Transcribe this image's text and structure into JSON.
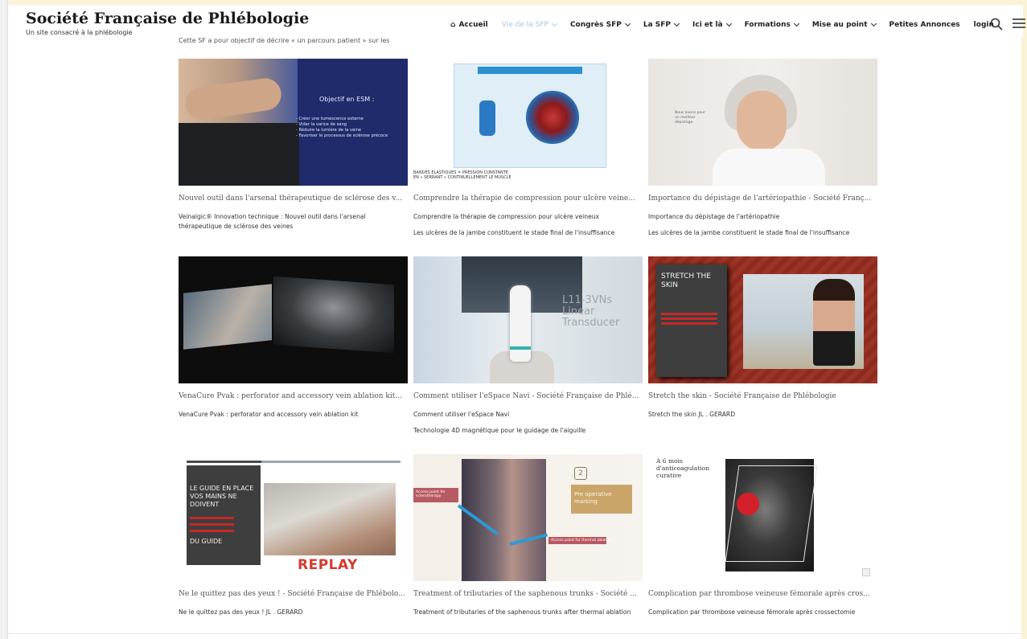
{
  "site": {
    "title": "Société Française de Phlébologie",
    "subtitle": "Un site consacré à la phlébologie"
  },
  "nav": {
    "items": [
      {
        "label": "Accueil",
        "icon": "home-icon",
        "dropdown": false,
        "active": false
      },
      {
        "label": "Vie de la SFP",
        "dropdown": true,
        "active": true
      },
      {
        "label": "Congrès SFP",
        "dropdown": true,
        "active": false
      },
      {
        "label": "La SFP",
        "dropdown": true,
        "active": false
      },
      {
        "label": "Ici et là",
        "dropdown": true,
        "active": false
      },
      {
        "label": "Formations",
        "dropdown": true,
        "active": false
      },
      {
        "label": "Mise au point",
        "dropdown": true,
        "active": false
      },
      {
        "label": "Petites Annonces",
        "dropdown": false,
        "active": false
      },
      {
        "label": "login",
        "dropdown": false,
        "active": false
      }
    ],
    "active_color": "#a6c8e8"
  },
  "intro": {
    "text": "Cette SF a pour objectif de décrire « un parcours patient » sur les"
  },
  "cards": [
    {
      "title": "Nouvel outil dans l'arsenal thérapeutique de sclérose des v...",
      "excerpt": "Veinalgic® Innovation technique : Nouvel outil dans l'arsenal thérapeutique de sclérose des veines",
      "extra": "",
      "thumb_text": {
        "heading": "Objectif en ESM :",
        "lines": [
          "- Créer une tumescence externe",
          "- Vider la varice de sang",
          "- Réduire la lumière de la veine",
          "- Favoriser le processus de sclérose précoce"
        ]
      }
    },
    {
      "title": "Comprendre la thérapie de compression pour ulcère veine...",
      "excerpt": "Comprendre la thérapie de compression pour ulcère veineux",
      "extra": "Les ulcères de la jambe constituent le stade final de l'insuffisance",
      "thumb_text": {
        "caption_1": "BANDES ÉLASTIQUES = PRESSION CONSTANTE",
        "caption_2": "EN « SERRANT » CONTINUELLEMENT LE MUSCLE"
      }
    },
    {
      "title": "Importance du dépistage de l'artériopathie - Société Franç...",
      "excerpt": "Importance du dépistage de l'artériopathie",
      "extra": "Les ulcères de la jambe constituent le stade final de l'insuffisance",
      "thumb_text": {
        "note": "Nous avons pour un meilleur dépistage."
      }
    },
    {
      "title": "VenaCure Pvak : perforator and accessory vein ablation kit...",
      "excerpt": "VenaCure Pvak : perforator and accessory vein ablation kit",
      "extra": ""
    },
    {
      "title": "Comment utiliser l'eSpace Navi - Société Française de Phlé...",
      "excerpt": "Comment utiliser l'eSpace Navi",
      "extra": "Technologie 4D magnétique pour le guidage de l'aiguille",
      "thumb_text": {
        "line_1": "L11-3VNs",
        "line_2": "Linear",
        "line_3": "Transducer"
      }
    },
    {
      "title": "Stretch the skin - Société Française de Phlébologie",
      "excerpt": "Stretch the skin JL . GERARD",
      "extra": "",
      "thumb_text": {
        "heading": "STRETCH THE SKIN"
      }
    },
    {
      "title": "Ne le quittez pas des yeux ! - Société Française de Phlébolo...",
      "excerpt": "Ne le quittez pas des yeux ! JL . GERARD",
      "extra": "",
      "thumb_text": {
        "heading": "LE GUIDE EN PLACE VOS MAINS NE DOIVENT",
        "tail": "DU GUIDE",
        "replay": "REPLAY"
      }
    },
    {
      "title": "Treatment of tributaries of the saphenous trunks - Société ...",
      "excerpt": "Treatment of tributaries of the saphenous trunks after thermal ablation",
      "extra": "",
      "thumb_text": {
        "tag_1": "Access point for sclerotherapy",
        "tag_2": "Access point for thermal ablation",
        "tag_3": "Pre operative marking",
        "num": "2"
      }
    },
    {
      "title": "Complication par thrombose veineuse fémorale après cros...",
      "excerpt": "Complication par thrombose veineuse fémorale après crossectomie",
      "extra": "",
      "thumb_text": {
        "note": "A 6 mois d'anticoagulation curative"
      }
    }
  ]
}
